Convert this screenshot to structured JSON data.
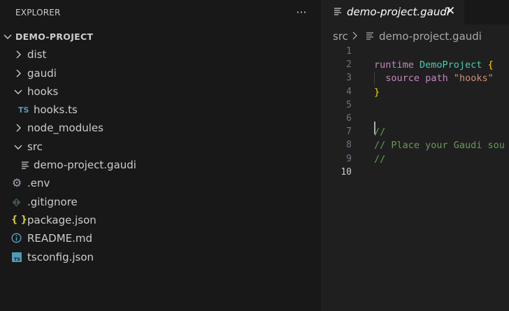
{
  "explorer": {
    "title": "EXPLORER",
    "more_icon": "ellipsis-icon",
    "root": "DEMO-PROJECT",
    "items": [
      {
        "label": "dist",
        "type": "folder",
        "expanded": false
      },
      {
        "label": "gaudi",
        "type": "folder",
        "expanded": false
      },
      {
        "label": "hooks",
        "type": "folder",
        "expanded": true
      },
      {
        "label": "hooks.ts",
        "type": "file",
        "icon_text": "TS",
        "icon_color": "#519aba"
      },
      {
        "label": "node_modules",
        "type": "folder",
        "expanded": false
      },
      {
        "label": "src",
        "type": "folder",
        "expanded": true
      },
      {
        "label": "demo-project.gaudi",
        "type": "file",
        "icon": "lines-file-icon"
      },
      {
        "label": ".env",
        "type": "file",
        "icon": "gear-icon"
      },
      {
        "label": ".gitignore",
        "type": "file",
        "icon": "git-icon"
      },
      {
        "label": "package.json",
        "type": "file",
        "icon_text": "{ }",
        "icon_color": "#cbcb41"
      },
      {
        "label": "README.md",
        "type": "file",
        "icon": "info-icon"
      },
      {
        "label": "tsconfig.json",
        "type": "file",
        "icon": "tsconfig-icon"
      }
    ]
  },
  "editor": {
    "tab": {
      "label": "demo-project.gaudi",
      "close": "✕"
    },
    "breadcrumb": {
      "folder": "src",
      "file": "demo-project.gaudi"
    },
    "lines": [
      {
        "n": "1",
        "tokens": []
      },
      {
        "n": "2",
        "tokens": [
          {
            "t": "runtime ",
            "c": "kw"
          },
          {
            "t": "DemoProject",
            "c": "cls"
          },
          {
            "t": " "
          },
          {
            "t": "{",
            "c": "brace"
          }
        ]
      },
      {
        "n": "3",
        "tokens": [
          {
            "t": "  "
          },
          {
            "t": "source",
            "c": "kw"
          },
          {
            "t": " "
          },
          {
            "t": "path",
            "c": "kw"
          },
          {
            "t": " "
          },
          {
            "t": "\"hooks\"",
            "c": "str"
          }
        ]
      },
      {
        "n": "4",
        "tokens": [
          {
            "t": "}",
            "c": "brace"
          }
        ]
      },
      {
        "n": "5",
        "tokens": []
      },
      {
        "n": "6",
        "tokens": []
      },
      {
        "n": "7",
        "tokens": [
          {
            "t": "//",
            "c": "cmt"
          }
        ]
      },
      {
        "n": "8",
        "tokens": [
          {
            "t": "// Place your Gaudi sou",
            "c": "cmt"
          }
        ]
      },
      {
        "n": "9",
        "tokens": [
          {
            "t": "//",
            "c": "cmt"
          }
        ]
      },
      {
        "n": "10",
        "tokens": [],
        "active": true
      }
    ]
  }
}
